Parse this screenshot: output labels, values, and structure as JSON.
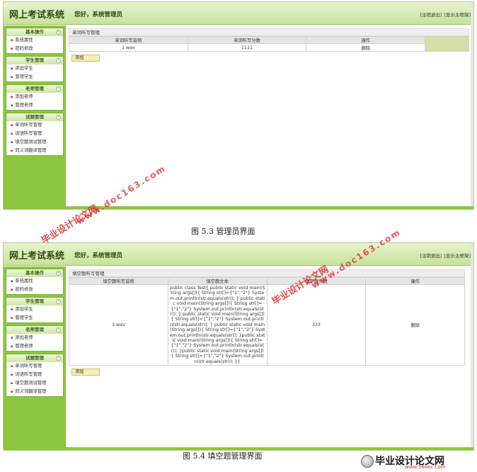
{
  "app_title": "网上考试系统",
  "greeting": "您好，系统管理员",
  "top_links": [
    "[注销退出]",
    "[显示主框架]"
  ],
  "sidebar": [
    {
      "header": "基本操作",
      "items": [
        "系统属性",
        "密码修改"
      ]
    },
    {
      "header": "学生管理",
      "items": [
        "添加学生",
        "管理学生"
      ]
    },
    {
      "header": "老师管理",
      "items": [
        "添加老师",
        "管理老师"
      ]
    },
    {
      "header": "试题管理",
      "items": [
        "单词听写管理",
        "词语听写管理",
        "填空题测试管理",
        "同义词翻译管理"
      ]
    }
  ],
  "toggle_glyph": "«",
  "screen1": {
    "panel_title": "单词听写管理",
    "columns": [
      "单词听写音频",
      "单词听写分数",
      "操作"
    ],
    "rows": [
      {
        "audio": "1.wav",
        "score": "1111",
        "action": "删除"
      }
    ],
    "add_label": "添加"
  },
  "screen2": {
    "panel_title": "填空题听写管理",
    "columns": [
      "填空题听写音频",
      "填空题文本",
      "填空题分数",
      "操作"
    ],
    "rows": [
      {
        "audio": "3.wav",
        "text": "public class Test{ public static void main(String args[]){ String str[]={\"1\",\"2\"} System.out.println(str.equals(str)); } public static void main(String args[]){ String str[]={\"1\",\"2\"} System.out.println(str.equals(str)); } public static void main(String args[]){ String str[]={\"1\",\"2\"} System.out.println(str.equals(str)); } public static void main(String args[]){ String str[]={\"1\",\"2\"} System.out.println(str.equals(str)); }public static void main(String args[]){ String str[]={\"1\",\"2\"} System.out.println(str.equals(str)); }public static void main(String args[]){ String str[]={\"1\",\"2\"} System.out.println(str.equals(str)); }}",
        "score": "333",
        "action": "删除"
      }
    ],
    "add_label": "添加"
  },
  "captions": {
    "fig1": "图 5.3 管理员界面",
    "fig2": "图 5.4 填空题管理界面"
  },
  "watermarks": {
    "cn": "毕业设计论文网",
    "url": "www.doc163.com"
  },
  "logo": {
    "name": "毕业设计论文网",
    "site": "www.56doc.com"
  },
  "colors": {
    "sidebar_green": "#8cc63f",
    "header_green": "#c7e29a",
    "add_button": "#f5efb4",
    "highlight_cell": "#d3dfa5",
    "watermark_red": "#dc1e1e"
  }
}
